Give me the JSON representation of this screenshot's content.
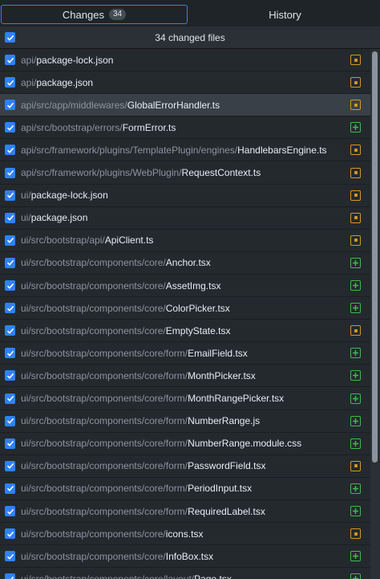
{
  "tabs": {
    "changes_label": "Changes",
    "changes_count": "34",
    "history_label": "History"
  },
  "header": {
    "summary": "34 changed files"
  },
  "colors": {
    "accent": "#2f81f7",
    "modified": "#d29922",
    "added": "#3fb950"
  },
  "files": [
    {
      "dir": "api/",
      "name": "package-lock.json",
      "status": "modified"
    },
    {
      "dir": "api/",
      "name": "package.json",
      "status": "modified"
    },
    {
      "dir": "api/src/app/middlewares/",
      "name": "GlobalErrorHandler.ts",
      "status": "modified"
    },
    {
      "dir": "api/src/bootstrap/errors/",
      "name": "FormError.ts",
      "status": "added"
    },
    {
      "dir": "api/src/framework/plugins/TemplatePlugin/engines/",
      "name": "HandlebarsEngine.ts",
      "status": "modified"
    },
    {
      "dir": "api/src/framework/plugins/WebPlugin/",
      "name": "RequestContext.ts",
      "status": "modified"
    },
    {
      "dir": "ui/",
      "name": "package-lock.json",
      "status": "modified"
    },
    {
      "dir": "ui/",
      "name": "package.json",
      "status": "modified"
    },
    {
      "dir": "ui/src/bootstrap/api/",
      "name": "ApiClient.ts",
      "status": "modified"
    },
    {
      "dir": "ui/src/bootstrap/components/core/",
      "name": "Anchor.tsx",
      "status": "added"
    },
    {
      "dir": "ui/src/bootstrap/components/core/",
      "name": "AssetImg.tsx",
      "status": "added"
    },
    {
      "dir": "ui/src/bootstrap/components/core/",
      "name": "ColorPicker.tsx",
      "status": "added"
    },
    {
      "dir": "ui/src/bootstrap/components/core/",
      "name": "EmptyState.tsx",
      "status": "modified"
    },
    {
      "dir": "ui/src/bootstrap/components/core/form/",
      "name": "EmailField.tsx",
      "status": "added"
    },
    {
      "dir": "ui/src/bootstrap/components/core/form/",
      "name": "MonthPicker.tsx",
      "status": "added"
    },
    {
      "dir": "ui/src/bootstrap/components/core/form/",
      "name": "MonthRangePicker.tsx",
      "status": "added"
    },
    {
      "dir": "ui/src/bootstrap/components/core/form/",
      "name": "NumberRange.js",
      "status": "added"
    },
    {
      "dir": "ui/src/bootstrap/components/core/form/",
      "name": "NumberRange.module.css",
      "status": "added"
    },
    {
      "dir": "ui/src/bootstrap/components/core/form/",
      "name": "PasswordField.tsx",
      "status": "modified"
    },
    {
      "dir": "ui/src/bootstrap/components/core/form/",
      "name": "PeriodInput.tsx",
      "status": "added"
    },
    {
      "dir": "ui/src/bootstrap/components/core/form/",
      "name": "RequiredLabel.tsx",
      "status": "added"
    },
    {
      "dir": "ui/src/bootstrap/components/core/",
      "name": "icons.tsx",
      "status": "modified"
    },
    {
      "dir": "ui/src/bootstrap/components/core/",
      "name": "InfoBox.tsx",
      "status": "added"
    },
    {
      "dir": "ui/src/bootstrap/components/core/layout/",
      "name": "Page.tsx",
      "status": "added"
    }
  ],
  "selected_index": 2
}
